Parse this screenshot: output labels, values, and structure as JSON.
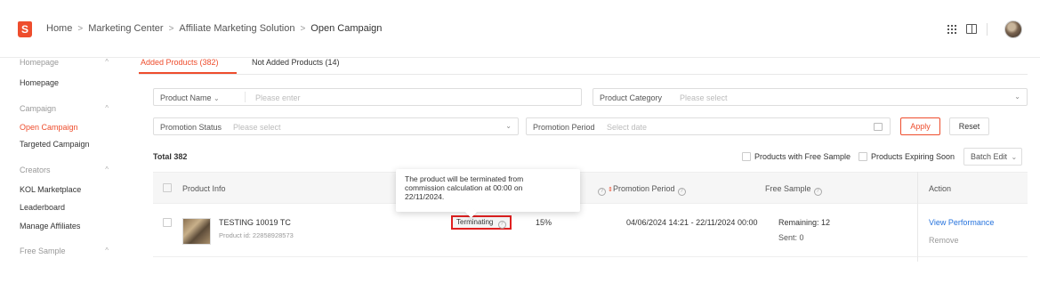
{
  "brand": {
    "logo_letter": "S",
    "accent": "#ee4d2d"
  },
  "breadcrumb": [
    "Home",
    "Marketing Center",
    "Affiliate Marketing Solution",
    "Open Campaign"
  ],
  "header_icons": [
    "apps-grid-icon",
    "book-icon",
    "avatar"
  ],
  "sidebar": {
    "groups": [
      {
        "label": "Homepage",
        "items": [
          "Homepage"
        ]
      },
      {
        "label": "Campaign",
        "items": [
          "Open Campaign",
          "Targeted Campaign"
        ]
      },
      {
        "label": "Creators",
        "items": [
          "KOL Marketplace",
          "Leaderboard",
          "Manage Affiliates"
        ]
      },
      {
        "label": "Free Sample",
        "items": []
      }
    ],
    "active_item": "Open Campaign"
  },
  "tabs": [
    {
      "label": "Added Products (382)",
      "active": true
    },
    {
      "label": "Not Added Products (14)",
      "active": false
    }
  ],
  "filters": {
    "product_name": {
      "select": "Product Name",
      "placeholder": "Please enter"
    },
    "product_category": {
      "label": "Product Category",
      "placeholder": "Please select"
    },
    "promotion_status": {
      "label": "Promotion Status",
      "placeholder": "Please select"
    },
    "promotion_period": {
      "label": "Promotion Period",
      "placeholder": "Select date"
    },
    "apply_label": "Apply",
    "reset_label": "Reset"
  },
  "toolbar": {
    "total": "Total 382",
    "free_sample_checkbox": "Products with Free Sample",
    "expiring_checkbox": "Products Expiring Soon",
    "batch_edit": "Batch Edit"
  },
  "table": {
    "headers": {
      "product_info": "Product Info",
      "promotion_period": "Promotion Period",
      "free_sample": "Free Sample",
      "action": "Action"
    },
    "rows": [
      {
        "name": "TESTING 10019 TC",
        "product_id": "Product id: 22858928573",
        "status": "Terminating",
        "commission": "15%",
        "period": "04/06/2024 14:21 - 22/11/2024 00:00",
        "free_sample_remaining": "Remaining: 12",
        "free_sample_sent": "Sent: 0",
        "action_primary": "View Performance",
        "action_secondary": "Remove"
      }
    ]
  },
  "tooltip": {
    "text_line1": "The product will be terminated from",
    "text_line2": "commission calculation at 00:00 on",
    "text_line3": "22/11/2024."
  }
}
